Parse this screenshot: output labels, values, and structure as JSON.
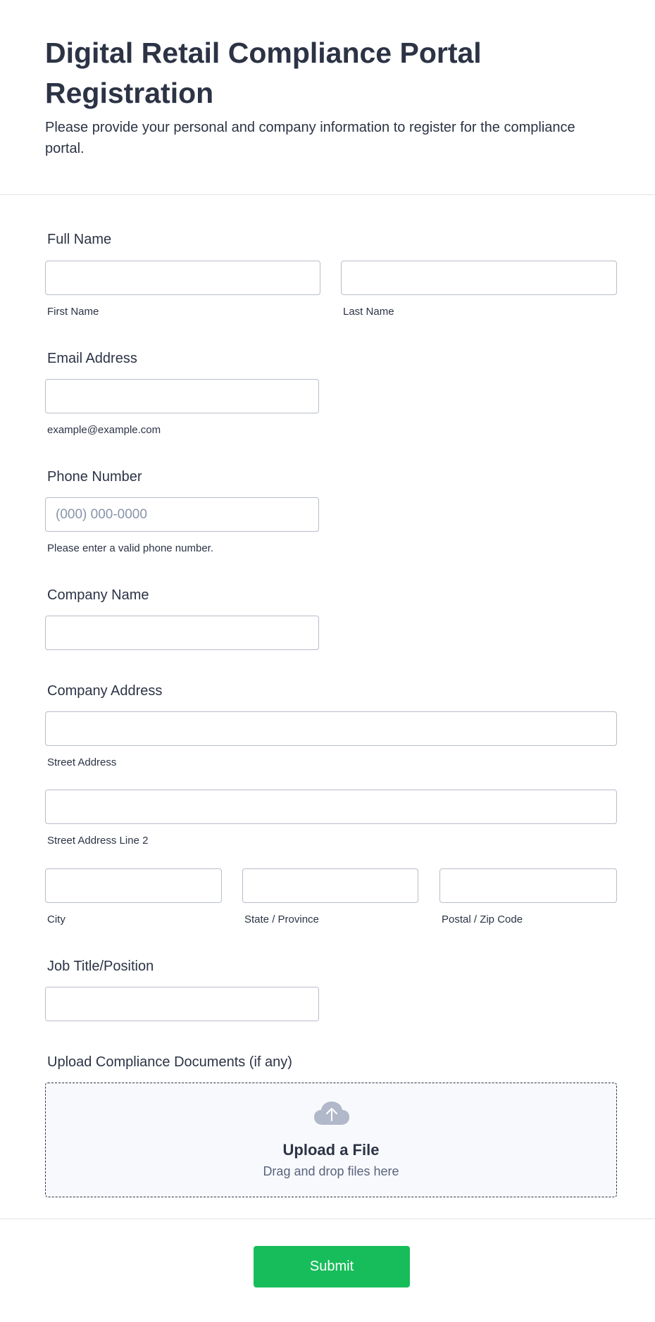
{
  "header": {
    "title": "Digital Retail Compliance Portal Registration",
    "subtitle": "Please provide your personal and company information to register for the compliance portal."
  },
  "form": {
    "full_name": {
      "label": "Full Name",
      "first_sub": "First Name",
      "last_sub": "Last Name",
      "first_value": "",
      "last_value": ""
    },
    "email": {
      "label": "Email Address",
      "sub": "example@example.com",
      "value": ""
    },
    "phone": {
      "label": "Phone Number",
      "placeholder": "(000) 000-0000",
      "sub": "Please enter a valid phone number.",
      "value": ""
    },
    "company_name": {
      "label": "Company Name",
      "value": ""
    },
    "company_address": {
      "label": "Company Address",
      "street_sub": "Street Address",
      "street2_sub": "Street Address Line 2",
      "city_sub": "City",
      "state_sub": "State / Province",
      "zip_sub": "Postal / Zip Code"
    },
    "job_title": {
      "label": "Job Title/Position",
      "value": ""
    },
    "upload": {
      "label": "Upload Compliance Documents (if any)",
      "title": "Upload a File",
      "hint": "Drag and drop files here",
      "icon": "cloud-upload-icon"
    },
    "submit_label": "Submit"
  },
  "colors": {
    "text": "#2c3345",
    "border": "#b8bdc9",
    "submit": "#18bd5b",
    "upload_bg": "#f8f9fc",
    "placeholder": "#8894ab"
  }
}
